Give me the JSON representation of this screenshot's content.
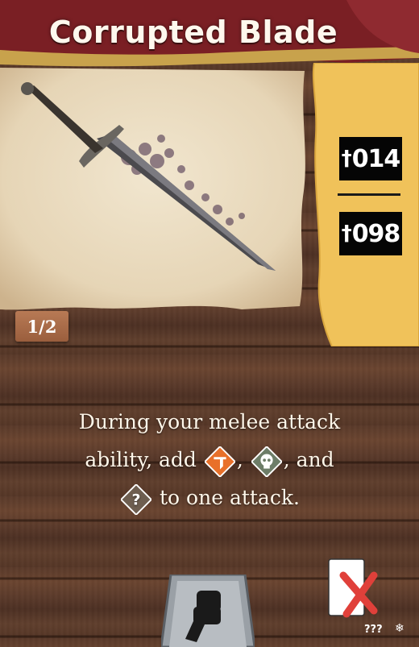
{
  "card": {
    "title": "Corrupted Blade",
    "page_indicator": "1/2",
    "stats": [
      {
        "dagger": "†",
        "value": "014"
      },
      {
        "dagger": "†",
        "value": "098"
      }
    ],
    "ability": {
      "line1": "During your melee attack",
      "line2_start": "ability, add",
      "sep1": ",",
      "line2_end": ", and",
      "line3_end": "to one attack."
    },
    "icons": [
      "bleed-icon",
      "poison-skull-icon",
      "mystery-question-icon",
      "fist-icon",
      "lost-card-icon",
      "snowflake-icon"
    ],
    "question_glyph": "?",
    "footer_code": "???",
    "snowflake": "❄"
  },
  "colors": {
    "banner": "#7a1f24",
    "parchment": "#eadcc0",
    "yellow_tab": "#f0c25a",
    "bleed": "#e8702a",
    "poison": "#6d7d68",
    "mystery": "#6e5e50",
    "lost_x": "#e0403a"
  }
}
